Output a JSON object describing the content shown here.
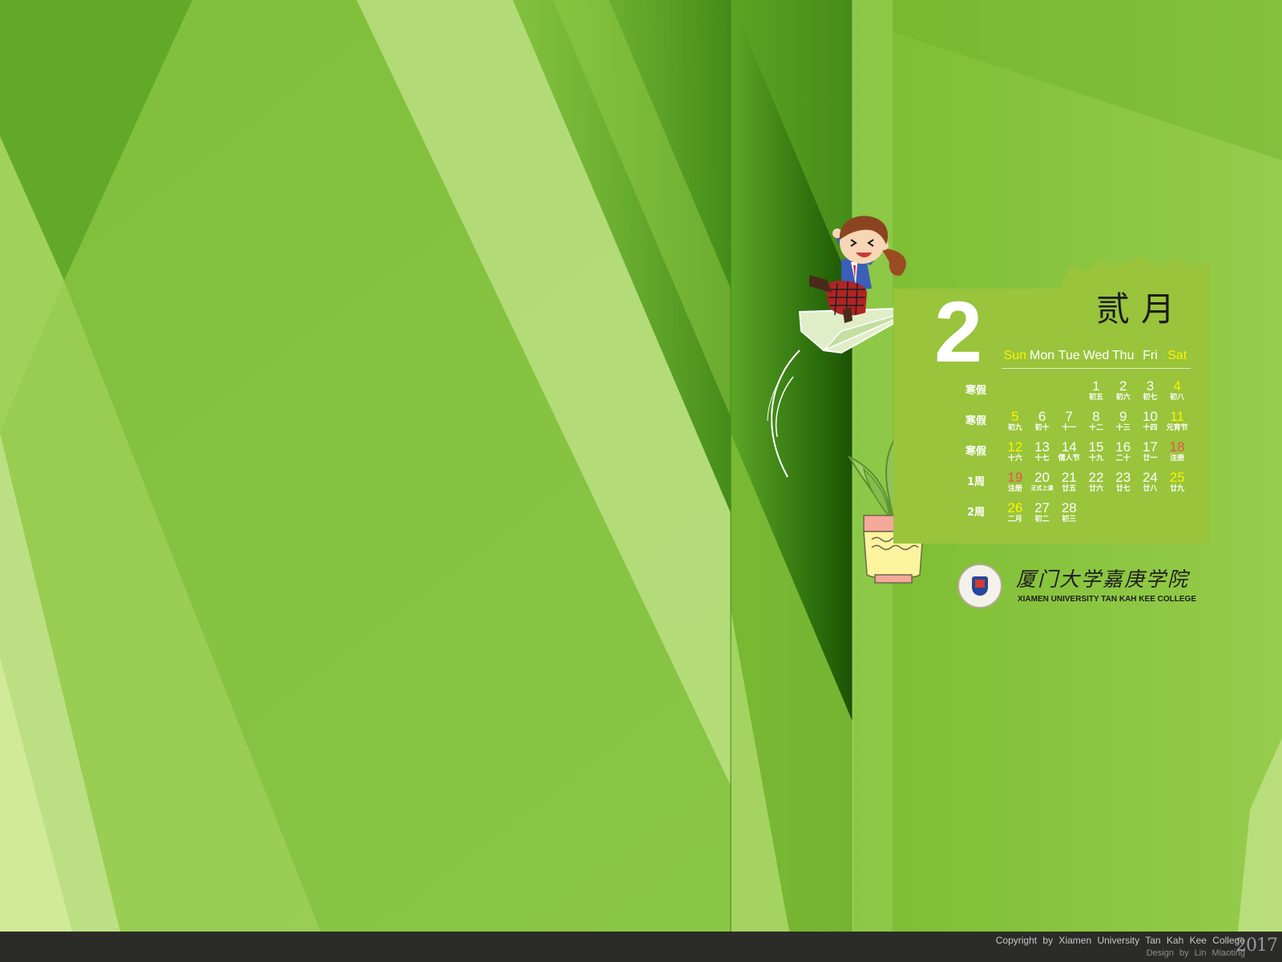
{
  "calendar": {
    "month_number": "2",
    "month_cn": "贰月",
    "weekdays": [
      "Sun",
      "Mon",
      "Tue",
      "Wed",
      "Thu",
      "Fri",
      "Sat"
    ],
    "week_labels": [
      "寒假",
      "寒假",
      "寒假",
      "1周",
      "2周"
    ],
    "weeks": [
      [
        {
          "day": "",
          "lunar": ""
        },
        {
          "day": "",
          "lunar": ""
        },
        {
          "day": "",
          "lunar": ""
        },
        {
          "day": "1",
          "lunar": "初五"
        },
        {
          "day": "2",
          "lunar": "初六"
        },
        {
          "day": "3",
          "lunar": "初七"
        },
        {
          "day": "4",
          "lunar": "初八"
        }
      ],
      [
        {
          "day": "5",
          "lunar": "初九"
        },
        {
          "day": "6",
          "lunar": "初十"
        },
        {
          "day": "7",
          "lunar": "十一"
        },
        {
          "day": "8",
          "lunar": "十二"
        },
        {
          "day": "9",
          "lunar": "十三"
        },
        {
          "day": "10",
          "lunar": "十四"
        },
        {
          "day": "11",
          "lunar": "元宵节"
        }
      ],
      [
        {
          "day": "12",
          "lunar": "十六"
        },
        {
          "day": "13",
          "lunar": "十七"
        },
        {
          "day": "14",
          "lunar": "情人节"
        },
        {
          "day": "15",
          "lunar": "十九"
        },
        {
          "day": "16",
          "lunar": "二十"
        },
        {
          "day": "17",
          "lunar": "廿一"
        },
        {
          "day": "18",
          "lunar": "注册"
        }
      ],
      [
        {
          "day": "19",
          "lunar": "注册"
        },
        {
          "day": "20",
          "lunar": "正式上课"
        },
        {
          "day": "21",
          "lunar": "廿五"
        },
        {
          "day": "22",
          "lunar": "廿六"
        },
        {
          "day": "23",
          "lunar": "廿七"
        },
        {
          "day": "24",
          "lunar": "廿八"
        },
        {
          "day": "25",
          "lunar": "廿九"
        }
      ],
      [
        {
          "day": "26",
          "lunar": "二月"
        },
        {
          "day": "27",
          "lunar": "初二"
        },
        {
          "day": "28",
          "lunar": "初三"
        },
        {
          "day": "",
          "lunar": ""
        },
        {
          "day": "",
          "lunar": ""
        },
        {
          "day": "",
          "lunar": ""
        },
        {
          "day": "",
          "lunar": ""
        }
      ]
    ]
  },
  "colors": {
    "weekend": "#fff200",
    "registration": "#e8544c",
    "panel": "#99c43c"
  },
  "logo": {
    "cn_name": "厦门大学嘉庚学院",
    "en_name": "XIAMEN UNIVERSITY TAN KAH KEE COLLEGE"
  },
  "footer": {
    "copyright": "Copyright by Xiamen University Tan Kah Kee College",
    "design_by": "Design by Lin Miaoting",
    "year": "2017"
  },
  "illustrations": {
    "character": "girl-on-paper-plane-icon",
    "plant": "potted-plant-icon"
  }
}
